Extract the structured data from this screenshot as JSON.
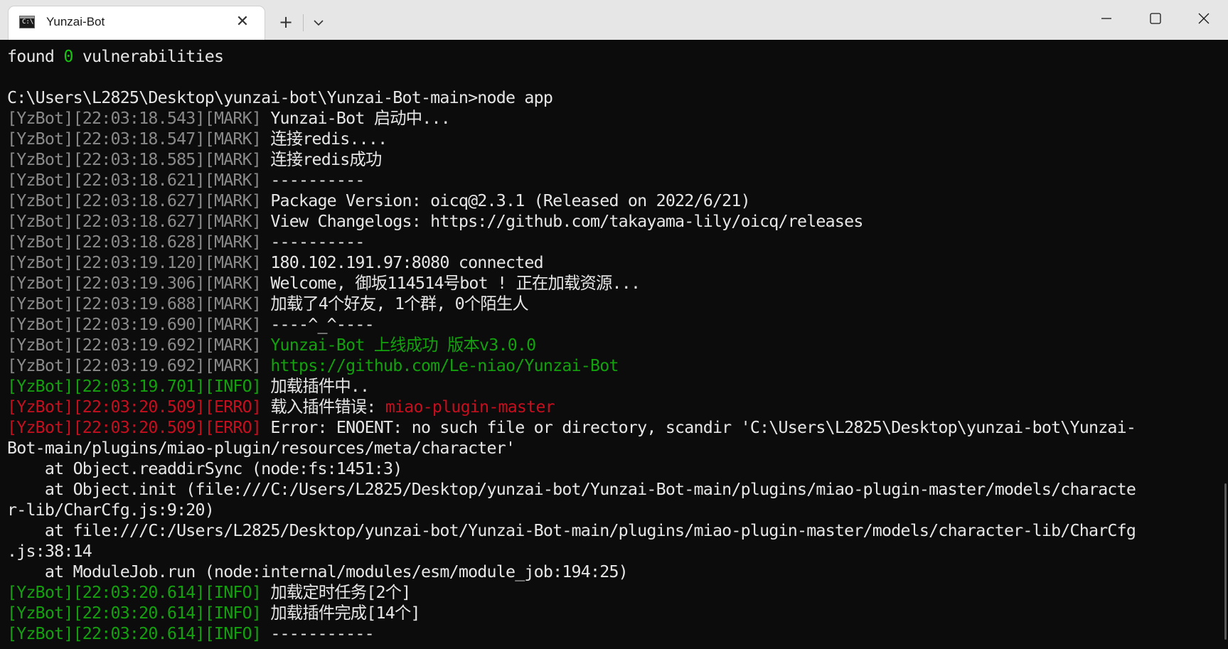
{
  "window": {
    "tab_title": "Yunzai-Bot",
    "tab_icon_glyph": "C:\\",
    "close_tab_glyph": "✕",
    "new_tab_glyph": "+",
    "colors": {
      "background": "#0c0c0c",
      "titlebar": "#e6e6e6",
      "gray_text": "#8a8a8a",
      "white_text": "#e6e6e6",
      "green": "#13a10e",
      "red": "#c50f1f"
    }
  },
  "terminal": {
    "line0": [
      {
        "text": "found ",
        "color": "white"
      },
      {
        "text": "0",
        "color": "bright-green"
      },
      {
        "text": " vulnerabilities",
        "color": "white"
      }
    ],
    "line1": [
      {
        "text": "",
        "color": "white"
      }
    ],
    "line2": [
      {
        "text": "C:\\Users\\L2825\\Desktop\\yunzai-bot\\Yunzai-Bot-main>node app",
        "color": "white"
      }
    ],
    "line3": [
      {
        "text": "[YzBot][22:03:18.543][MARK] ",
        "color": "gray"
      },
      {
        "text": "Yunzai-Bot 启动中...",
        "color": "white"
      }
    ],
    "line4": [
      {
        "text": "[YzBot][22:03:18.547][MARK] ",
        "color": "gray"
      },
      {
        "text": "连接redis....",
        "color": "white"
      }
    ],
    "line5": [
      {
        "text": "[YzBot][22:03:18.585][MARK] ",
        "color": "gray"
      },
      {
        "text": "连接redis成功",
        "color": "white"
      }
    ],
    "line6": [
      {
        "text": "[YzBot][22:03:18.621][MARK] ",
        "color": "gray"
      },
      {
        "text": "----------",
        "color": "white"
      }
    ],
    "line7": [
      {
        "text": "[YzBot][22:03:18.627][MARK] ",
        "color": "gray"
      },
      {
        "text": "Package Version: oicq@2.3.1 (Released on 2022/6/21)",
        "color": "white"
      }
    ],
    "line8": [
      {
        "text": "[YzBot][22:03:18.627][MARK] ",
        "color": "gray"
      },
      {
        "text": "View Changelogs: https://github.com/takayama-lily/oicq/releases",
        "color": "white"
      }
    ],
    "line9": [
      {
        "text": "[YzBot][22:03:18.628][MARK] ",
        "color": "gray"
      },
      {
        "text": "----------",
        "color": "white"
      }
    ],
    "line10": [
      {
        "text": "[YzBot][22:03:19.120][MARK] ",
        "color": "gray"
      },
      {
        "text": "180.102.191.97:8080 connected",
        "color": "white"
      }
    ],
    "line11": [
      {
        "text": "[YzBot][22:03:19.306][MARK] ",
        "color": "gray"
      },
      {
        "text": "Welcome, 御坂114514号bot ! 正在加载资源...",
        "color": "white"
      }
    ],
    "line12": [
      {
        "text": "[YzBot][22:03:19.688][MARK] ",
        "color": "gray"
      },
      {
        "text": "加载了4个好友, 1个群, 0个陌生人",
        "color": "white"
      }
    ],
    "line13": [
      {
        "text": "[YzBot][22:03:19.690][MARK] ",
        "color": "gray"
      },
      {
        "text": "----^_^----",
        "color": "white"
      }
    ],
    "line14": [
      {
        "text": "[YzBot][22:03:19.692][MARK] ",
        "color": "gray"
      },
      {
        "text": "Yunzai-Bot 上线成功 版本v3.0.0",
        "color": "green"
      }
    ],
    "line15": [
      {
        "text": "[YzBot][22:03:19.692][MARK] ",
        "color": "gray"
      },
      {
        "text": "https://github.com/Le-niao/Yunzai-Bot",
        "color": "green"
      }
    ],
    "line16": [
      {
        "text": "[YzBot][22:03:19.701][INFO] ",
        "color": "green"
      },
      {
        "text": "加载插件中..",
        "color": "white"
      }
    ],
    "line17": [
      {
        "text": "[YzBot][22:03:20.509][ERRO] ",
        "color": "red"
      },
      {
        "text": "载入插件错误: ",
        "color": "white"
      },
      {
        "text": "miao-plugin-master",
        "color": "red"
      }
    ],
    "line18": [
      {
        "text": "[YzBot][22:03:20.509][ERRO] ",
        "color": "red"
      },
      {
        "text": "Error: ENOENT: no such file or directory, scandir 'C:\\Users\\L2825\\Desktop\\yunzai-bot\\Yunzai-",
        "color": "white"
      }
    ],
    "line19": [
      {
        "text": "Bot-main/plugins/miao-plugin/resources/meta/character'",
        "color": "white"
      }
    ],
    "line20": [
      {
        "text": "    at Object.readdirSync (node:fs:1451:3)",
        "color": "white"
      }
    ],
    "line21": [
      {
        "text": "    at Object.init (file:///C:/Users/L2825/Desktop/yunzai-bot/Yunzai-Bot-main/plugins/miao-plugin-master/models/characte",
        "color": "white"
      }
    ],
    "line22": [
      {
        "text": "r-lib/CharCfg.js:9:20)",
        "color": "white"
      }
    ],
    "line23": [
      {
        "text": "    at file:///C:/Users/L2825/Desktop/yunzai-bot/Yunzai-Bot-main/plugins/miao-plugin-master/models/character-lib/CharCfg",
        "color": "white"
      }
    ],
    "line24": [
      {
        "text": ".js:38:14",
        "color": "white"
      }
    ],
    "line25": [
      {
        "text": "    at ModuleJob.run (node:internal/modules/esm/module_job:194:25)",
        "color": "white"
      }
    ],
    "line26": [
      {
        "text": "[YzBot][22:03:20.614][INFO] ",
        "color": "green"
      },
      {
        "text": "加载定时任务[2个]",
        "color": "white"
      }
    ],
    "line27": [
      {
        "text": "[YzBot][22:03:20.614][INFO] ",
        "color": "green"
      },
      {
        "text": "加载插件完成[14个]",
        "color": "white"
      }
    ],
    "line28": [
      {
        "text": "[YzBot][22:03:20.614][INFO] ",
        "color": "green"
      },
      {
        "text": "-----------",
        "color": "white"
      }
    ]
  }
}
